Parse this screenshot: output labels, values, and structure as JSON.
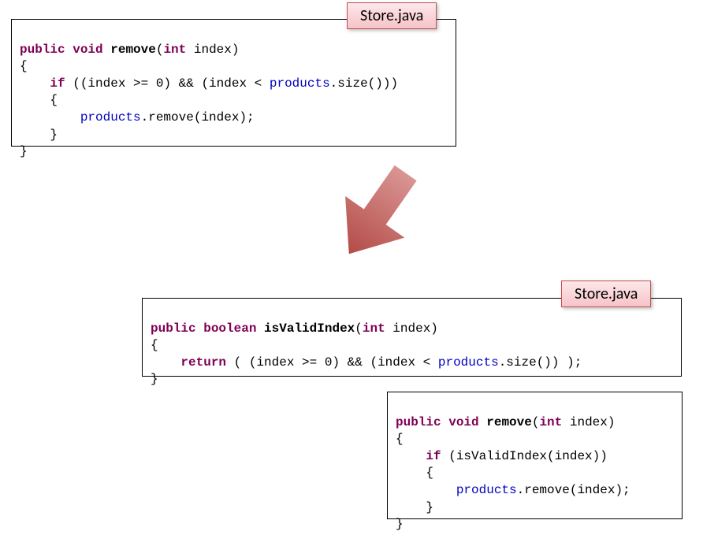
{
  "box1": {
    "label": "Store.java",
    "l1a": "public",
    "l1b": "void",
    "l1c": "remove",
    "l1d": "(",
    "l1e": "int",
    "l1f": " index)",
    "l2": "{",
    "l3a": "    ",
    "l3b": "if",
    "l3c": " ((index >= ",
    "l3d": "0",
    "l3e": ") && (index < ",
    "l3f": "products",
    "l3g": ".size()))",
    "l4": "    {",
    "l5a": "        ",
    "l5b": "products",
    "l5c": ".remove(index);",
    "l6": "    }",
    "l7": "}"
  },
  "box2": {
    "label": "Store.java",
    "l1a": "public",
    "l1b": "boolean",
    "l1c": "isValidIndex",
    "l1d": "(",
    "l1e": "int",
    "l1f": " index)",
    "l2": "{",
    "l3a": "    ",
    "l3b": "return",
    "l3c": " ( (index >= ",
    "l3d": "0",
    "l3e": ") && (index < ",
    "l3f": "products",
    "l3g": ".size()) );",
    "l4": "}"
  },
  "box3": {
    "l1a": "public",
    "l1b": "void",
    "l1c": "remove",
    "l1d": "(",
    "l1e": "int",
    "l1f": " index)",
    "l2": "{",
    "l3a": "    ",
    "l3b": "if",
    "l3c": " (isValidIndex(index))",
    "l4": "    {",
    "l5a": "        ",
    "l5b": "products",
    "l5c": ".remove(index);",
    "l6": "    }",
    "l7": "}"
  }
}
